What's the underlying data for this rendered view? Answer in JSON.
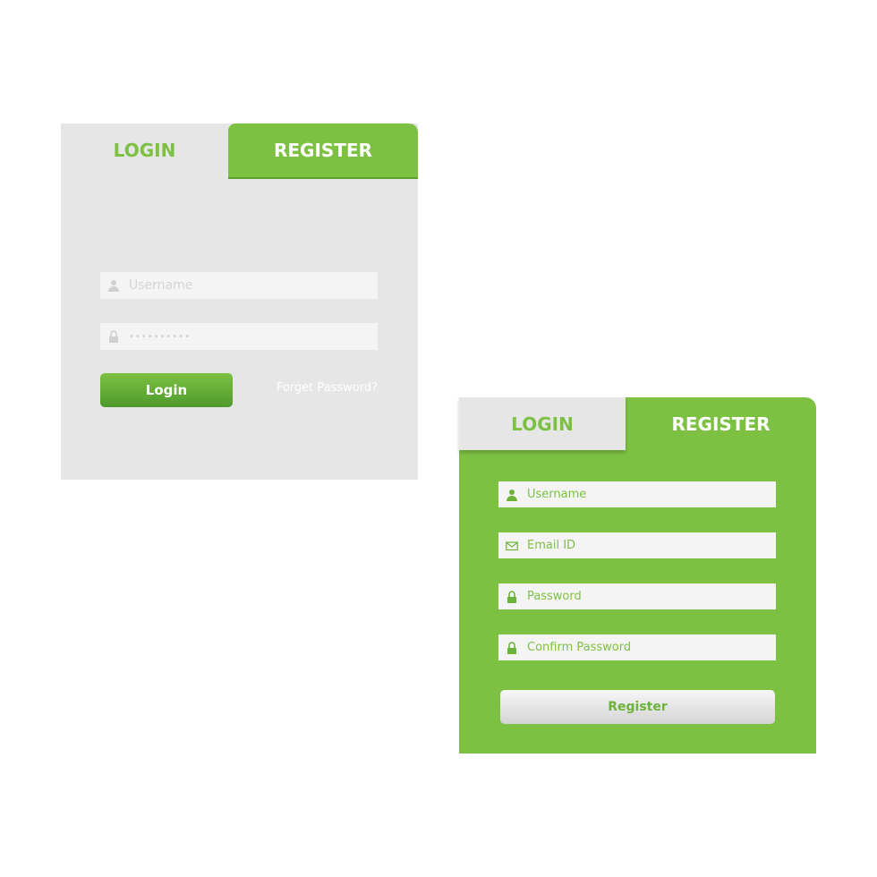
{
  "colors": {
    "accent": "#7cc142",
    "panel": "#e6e6e6",
    "input": "#f4f4f4"
  },
  "login_form": {
    "tabs": [
      {
        "label": "LOGIN",
        "active": true
      },
      {
        "label": "REGISTER",
        "active": false
      }
    ],
    "username_placeholder": "Username",
    "password_value": "••••••••••",
    "login_button": "Login",
    "forgot_link": "Forget Password?"
  },
  "register_form": {
    "tabs": [
      {
        "label": "LOGIN",
        "active": false
      },
      {
        "label": "REGISTER",
        "active": true
      }
    ],
    "fields": [
      {
        "placeholder": "Username",
        "icon": "user-icon"
      },
      {
        "placeholder": "Email ID",
        "icon": "envelope-icon"
      },
      {
        "placeholder": "Password",
        "icon": "lock-icon"
      },
      {
        "placeholder": "Confirm Password",
        "icon": "lock-icon"
      }
    ],
    "register_button": "Register"
  }
}
